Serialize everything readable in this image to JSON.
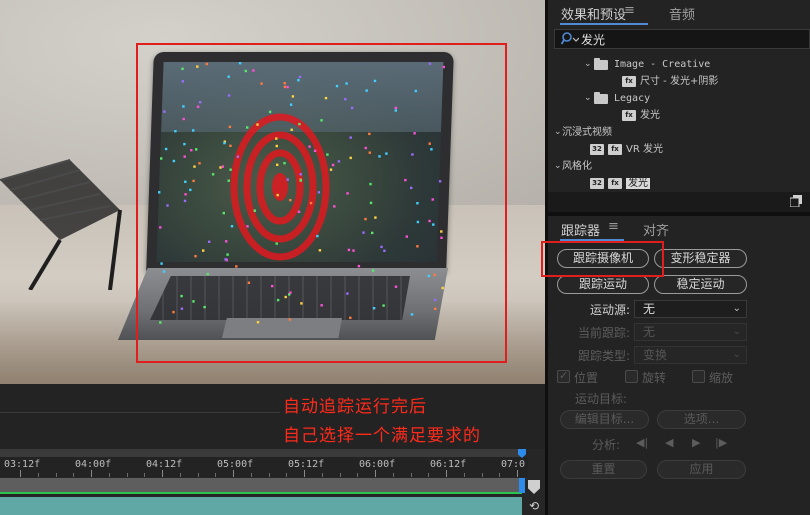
{
  "viewer": {
    "annotation_line1": "自动追踪运行完后",
    "annotation_line2": "自己选择一个满足要求的",
    "highlight_color": "#e01e1e",
    "annotation_color": "#ff2a1a"
  },
  "timeline": {
    "ticks": [
      "03:12f",
      "04:00f",
      "04:12f",
      "05:00f",
      "05:12f",
      "06:00f",
      "06:12f",
      "07:0"
    ],
    "playhead_color": "#2d8ceb",
    "work_area_color": "#2bc450",
    "layer_color": "#5fa8a5"
  },
  "effects_panel": {
    "tab_effects": "效果和预设",
    "menu_icon": "≡",
    "tab_presets": "音频",
    "search_value": "发光",
    "search_icon": "search-icon",
    "tree": [
      {
        "type": "folder",
        "label": "Image - Creative",
        "indent": 1,
        "mono": true
      },
      {
        "type": "preset",
        "label": "尺寸 - 发光+阴影",
        "indent": 2,
        "mono": false
      },
      {
        "type": "folder",
        "label": "Legacy",
        "indent": 1,
        "mono": true
      },
      {
        "type": "preset",
        "label": "发光",
        "indent": 2,
        "mono": false
      },
      {
        "type": "category",
        "label": "沉浸式视频",
        "indent": 0,
        "mono": false
      },
      {
        "type": "effect",
        "label": "VR 发光",
        "indent": 1,
        "mono": false
      },
      {
        "type": "category",
        "label": "风格化",
        "indent": 0,
        "mono": false
      },
      {
        "type": "effect",
        "label": "发光",
        "indent": 1,
        "mono": false,
        "selected": true
      }
    ],
    "accent_color": "#4f8ad6"
  },
  "tracker_panel": {
    "tab_tracker": "跟踪器",
    "menu_icon": "≡",
    "tab_align": "对齐",
    "btn_track_camera": "跟踪摄像机",
    "btn_warp_stabilizer": "变形稳定器",
    "btn_track_motion": "跟踪运动",
    "btn_stabilize_motion": "稳定运动",
    "motion_source_label": "运动源:",
    "motion_source_value": "无",
    "current_track_label": "当前跟踪:",
    "current_track_value": "无",
    "track_type_label": "跟踪类型:",
    "track_type_value": "变换",
    "chk_position": "位置",
    "chk_rotation": "旋转",
    "chk_scale": "缩放",
    "motion_target_label": "运动目标:",
    "btn_edit_target": "编辑目标...",
    "btn_options": "选项...",
    "analyze_label": "分析:",
    "btn_reset": "重置",
    "btn_apply": "应用"
  }
}
